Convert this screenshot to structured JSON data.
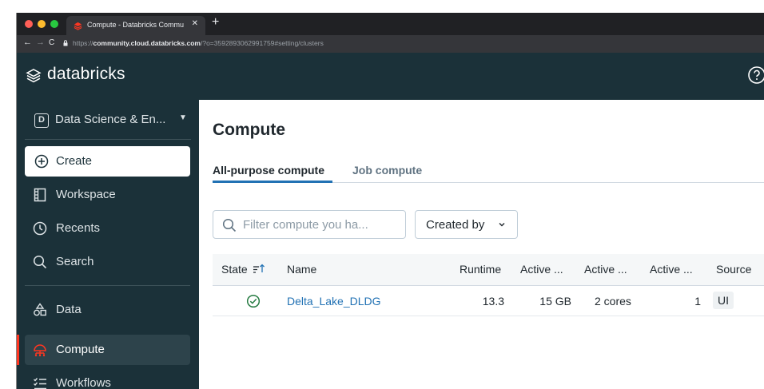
{
  "browser": {
    "tab_title": "Compute - Databricks Commu",
    "url_prefix": "https://",
    "url_host": "community.cloud.databricks.com",
    "url_path": "/?o=3592893062991759#setting/clusters",
    "colors": {
      "close": "#ff5f57",
      "minimize": "#febc2e",
      "maximize": "#28c840"
    }
  },
  "app": {
    "logo_text": "databricks"
  },
  "sidebar": {
    "workspace_badge": "D",
    "workspace_label": "Data Science & En...",
    "create_label": "Create",
    "items": [
      {
        "label": "Workspace",
        "icon": "workspace-icon"
      },
      {
        "label": "Recents",
        "icon": "clock-icon"
      },
      {
        "label": "Search",
        "icon": "search-icon"
      },
      {
        "label": "Data",
        "icon": "data-icon"
      },
      {
        "label": "Compute",
        "icon": "compute-icon",
        "active": true
      },
      {
        "label": "Workflows",
        "icon": "workflows-icon"
      }
    ]
  },
  "main": {
    "title": "Compute",
    "tabs": [
      {
        "label": "All-purpose compute",
        "active": true
      },
      {
        "label": "Job compute",
        "active": false
      }
    ],
    "filter_placeholder": "Filter compute you ha...",
    "created_by_label": "Created by",
    "table": {
      "columns": [
        "State",
        "Name",
        "Runtime",
        "Active ...",
        "Active ...",
        "Active ...",
        "Source"
      ],
      "rows": [
        {
          "state": "running",
          "name": "Delta_Lake_DLDG",
          "runtime": "13.3",
          "memory": "15 GB",
          "cores": "2 cores",
          "dbu": "1",
          "source": "UI"
        }
      ]
    }
  },
  "accent_colors": {
    "brand_dark": "#1b3139",
    "link": "#2272b4",
    "active_marker": "#ff3621",
    "success": "#277c43"
  }
}
